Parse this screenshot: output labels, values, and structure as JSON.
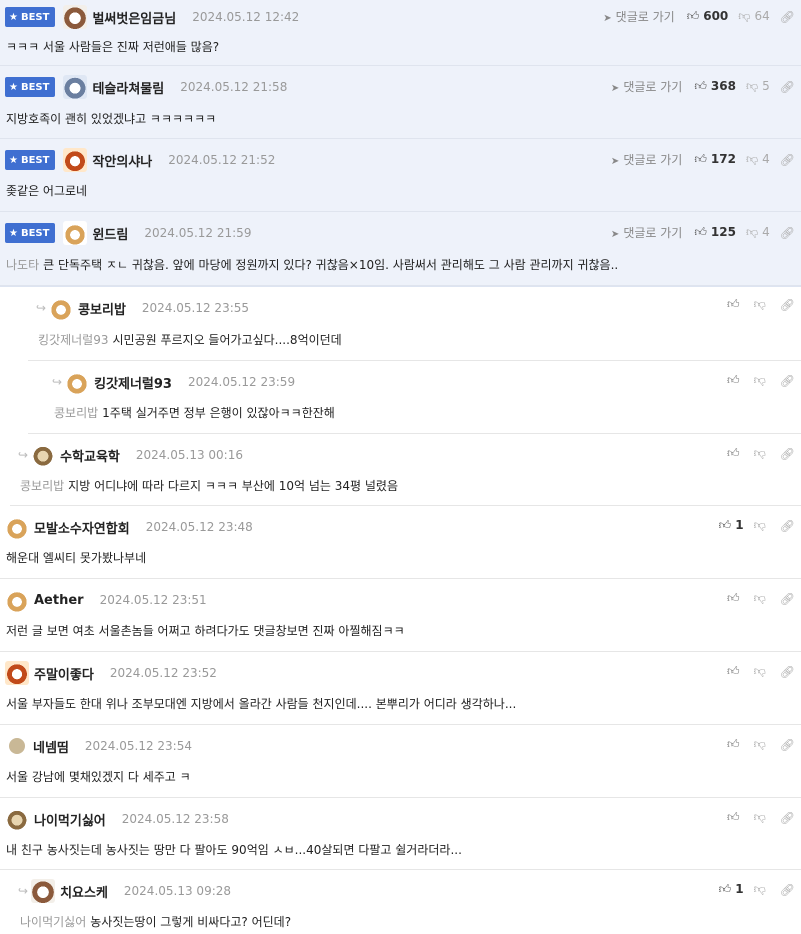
{
  "comments": [
    {
      "kind": "best",
      "badge": "BEST",
      "nickname": "벌써벗은임금님",
      "date": "2024.05.12 12:42",
      "goto": "댓글로 가기",
      "likes": "600",
      "dislikes": "64",
      "text": "ㅋㅋㅋ 서울 사람들은 진짜 저런애들 많음?"
    },
    {
      "kind": "best",
      "badge": "BEST",
      "nickname": "테슬라쳐물림",
      "date": "2024.05.12 21:58",
      "goto": "댓글로 가기",
      "likes": "368",
      "dislikes": "5",
      "text": "지방호족이 괜히 있었겠냐고 ㅋㅋㅋㅋㅋㅋ"
    },
    {
      "kind": "best",
      "badge": "BEST",
      "nickname": "작안의샤나",
      "date": "2024.05.12 21:52",
      "goto": "댓글로 가기",
      "likes": "172",
      "dislikes": "4",
      "text": "좆같은 어그로네"
    },
    {
      "kind": "best",
      "badge": "BEST",
      "nickname": "윈드림",
      "date": "2024.05.12 21:59",
      "goto": "댓글로 가기",
      "likes": "125",
      "dislikes": "4",
      "mention": "나도타",
      "text": "큰 단독주택 ㅈㄴ 귀찮음. 앞에 마당에 정원까지 있다? 귀찮음×10임. 사람써서 관리해도 그 사람 관리까지 귀찮음.."
    },
    {
      "kind": "reply",
      "nickname": "콩보리밥",
      "date": "2024.05.12 23:55",
      "mention": "킹갓제너럴93",
      "text": "시민공원 푸르지오 들어가고싶다....8억이던데"
    },
    {
      "kind": "reply",
      "nickname": "킹갓제너럴93",
      "date": "2024.05.12 23:59",
      "mention": "콩보리밥",
      "text": "1주택 실거주면 정부 은행이 있잖아ㅋㅋ한잔해"
    },
    {
      "kind": "reply",
      "nickname": "수학교육학",
      "date": "2024.05.13 00:16",
      "mention": "콩보리밥",
      "text": "지방 어디냐에 따라 다르지 ㅋㅋㅋ 부산에 10억 넘는 34평 널렸음"
    },
    {
      "kind": "normal",
      "nickname": "모발소수자연합회",
      "date": "2024.05.12 23:48",
      "likes": "1",
      "text": "해운대 엘씨티 못가봤나부네"
    },
    {
      "kind": "normal",
      "nickname": "Aether",
      "date": "2024.05.12 23:51",
      "text": "저런 글 보면 여초 서울촌놈들 어쩌고 하려다가도 댓글창보면 진짜 아찔해짐ㅋㅋ"
    },
    {
      "kind": "normal",
      "nickname": "주말이좋다",
      "date": "2024.05.12 23:52",
      "text": "서울 부자들도 한대 위나 조부모대엔 지방에서 올라간 사람들 천지인데.... 본뿌리가 어디라 생각하나..."
    },
    {
      "kind": "normal",
      "nickname": "네넴띰",
      "date": "2024.05.12 23:54",
      "text": "서울 강남에 몇채있겠지 다 세주고 ㅋ"
    },
    {
      "kind": "normal",
      "nickname": "나이먹기싫어",
      "date": "2024.05.12 23:58",
      "text": "내 친구 농사짓는데 농사짓는 땅만 다 팔아도 90억임 ㅅㅂ...40살되면 다팔고 쉴거라더라..."
    },
    {
      "kind": "reply",
      "nickname": "치요스케",
      "date": "2024.05.13 09:28",
      "likes": "1",
      "mention": "나이먹기싫어",
      "text": "농사짓는땅이 그렇게 비싸다고? 어딘데?"
    }
  ]
}
